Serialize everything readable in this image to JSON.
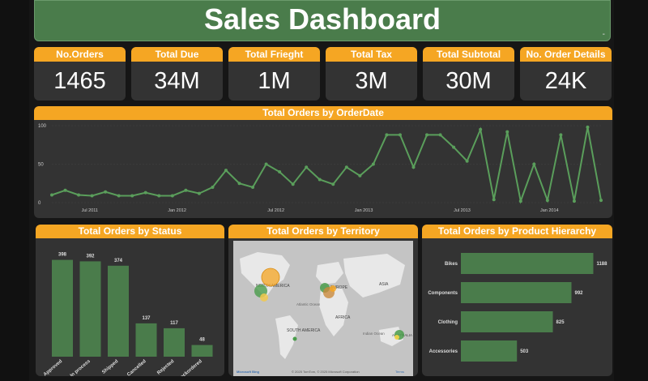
{
  "title": "Sales Dashboard",
  "title_mark": "-",
  "kpis": [
    {
      "label": "No.Orders",
      "value": "1465"
    },
    {
      "label": "Total Due",
      "value": "34M"
    },
    {
      "label": "Total Frieght",
      "value": "1M"
    },
    {
      "label": "Total Tax",
      "value": "3M"
    },
    {
      "label": "Total Subtotal",
      "value": "30M"
    },
    {
      "label": "No. Order Details",
      "value": "24K"
    }
  ],
  "colors": {
    "accent": "#f5a623",
    "green": "#4a7c4b",
    "panel": "#333333"
  },
  "line_panel": {
    "title": "Total Orders by OrderDate"
  },
  "status_panel": {
    "title": "Total Orders by Status"
  },
  "territory_panel": {
    "title": "Total Orders by Territory",
    "labels": {
      "north_america": "NORTH AMERICA",
      "europe": "EUROPE",
      "asia": "ASIA",
      "africa": "AFRICA",
      "south_america": "SOUTH AMERICA",
      "atlantic": "Atlantic Ocean",
      "indian": "Indian Ocean",
      "australia": "AUSTRALIA"
    },
    "footer": "© 2025 TomTom, © 2025 Microsoft Corporation",
    "terms": "Terms",
    "brand": "Microsoft Bing"
  },
  "hierarchy_panel": {
    "title": "Total Orders by Product Hierarchy"
  },
  "chart_data": [
    {
      "type": "line",
      "title": "Total Orders by OrderDate",
      "x_tick_labels": [
        "Jul 2011",
        "Jan 2012",
        "Jul 2012",
        "Jan 2013",
        "Jul 2013",
        "Jan 2014"
      ],
      "y_ticks": [
        "100",
        "50",
        "0"
      ],
      "ylim": [
        0,
        100
      ],
      "series": [
        {
          "values": [
            10,
            16,
            10,
            9,
            14,
            9,
            9,
            13,
            9,
            9,
            16,
            12,
            20,
            42,
            25,
            20,
            50,
            40,
            24,
            46,
            30,
            24,
            46,
            35,
            50,
            88,
            88,
            46,
            88,
            88,
            72,
            54,
            95,
            4,
            92,
            2,
            50,
            3,
            88,
            2,
            98,
            3
          ]
        }
      ]
    },
    {
      "type": "bar",
      "title": "Total Orders by Status",
      "categories": [
        "Approved",
        "In process",
        "Shipped",
        "Cancelled",
        "Rejected",
        "Backordered"
      ],
      "values": [
        398,
        392,
        374,
        137,
        117,
        48
      ],
      "ylim": [
        0,
        420
      ]
    },
    {
      "type": "bar",
      "orientation": "horizontal",
      "title": "Total Orders by Product Hierarchy",
      "categories": [
        "Bikes",
        "Components",
        "Clothing",
        "Accessories"
      ],
      "values": [
        1188,
        992,
        825,
        503
      ],
      "xlim": [
        0,
        1250
      ]
    }
  ]
}
